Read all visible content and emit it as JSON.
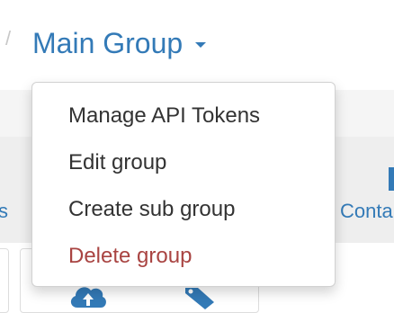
{
  "breadcrumb": {
    "separator": "/",
    "current": "Main Group"
  },
  "dropdown": {
    "items": [
      {
        "label": "Manage API Tokens"
      },
      {
        "label": "Edit group"
      },
      {
        "label": "Create sub group"
      },
      {
        "label": "Delete group",
        "color": "#a94442"
      }
    ]
  },
  "background": {
    "left_tab_fragment": "s",
    "right_tab_fragment": "Conta"
  },
  "icons": {
    "caret": "caret-down-icon",
    "cloud": "cloud-upload-icon",
    "tag": "tag-icon"
  },
  "colors": {
    "link": "#337ab7",
    "danger": "#a94442",
    "text": "#333333"
  }
}
